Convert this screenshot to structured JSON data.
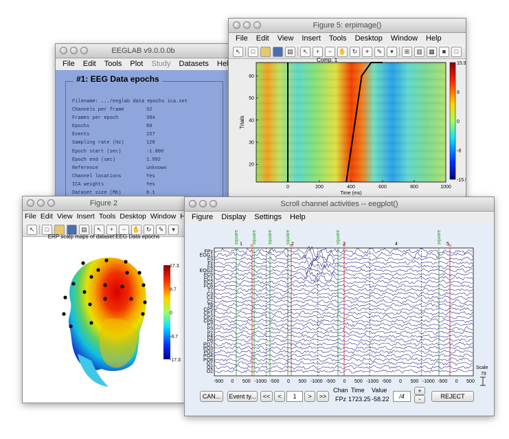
{
  "eeglab": {
    "title": "EEGLAB v9.0.0.0b",
    "menu": [
      "File",
      "Edit",
      "Tools",
      "Plot",
      "Study",
      "Datasets",
      "Help"
    ],
    "heading": "#1: EEG Data epochs",
    "info": [
      {
        "key": "Filename:  .../eeglab data epochs ica.set",
        "value": ""
      },
      {
        "key": "Channels per frame",
        "value": "32"
      },
      {
        "key": "Frames per epoch",
        "value": "384"
      },
      {
        "key": "Epochs",
        "value": "80"
      },
      {
        "key": "Events",
        "value": "157"
      },
      {
        "key": "Sampling rate (Hz)",
        "value": "128"
      },
      {
        "key": "Epoch start (sec)",
        "value": "-1.000"
      },
      {
        "key": "Epoch end (sec)",
        "value": "1.992"
      },
      {
        "key": "Reference",
        "value": "unknown"
      },
      {
        "key": "Channel locations",
        "value": "Yes"
      },
      {
        "key": "ICA weights",
        "value": "Yes"
      },
      {
        "key": "Dataset size (Mb)",
        "value": "8.1"
      }
    ]
  },
  "erpimage": {
    "title": "Figure 5: erpimage()",
    "menu": [
      "File",
      "Edit",
      "View",
      "Insert",
      "Tools",
      "Desktop",
      "Window",
      "Help"
    ],
    "plot_title": "Comp. 1",
    "xlabel": "Time (ms)",
    "ylabel": "Trials",
    "xticks": [
      "0",
      "200",
      "400",
      "600",
      "800",
      "1000"
    ],
    "yticks": [
      "20",
      "30",
      "40",
      "50",
      "60"
    ],
    "colorbar_ticks": [
      "15.9",
      "8",
      "0",
      "-8",
      "-15.9"
    ]
  },
  "figure2": {
    "title": "Figure 2",
    "menu": [
      "File",
      "Edit",
      "View",
      "Insert",
      "Tools",
      "Desktop",
      "Window",
      "Help"
    ],
    "plot_title": "ERP scalp maps of dataset:EEG Data epochs",
    "colorbar_ticks": [
      "17.3",
      "8.7",
      "0",
      "-8.7",
      "-17.3"
    ]
  },
  "eegplot": {
    "title": "Scroll channel activities -- eegplot()",
    "menu": [
      "Figure",
      "Display",
      "Settings",
      "Help"
    ],
    "event_labels": [
      "square",
      "square",
      "square",
      "square",
      "square",
      "square"
    ],
    "epoch_numbers": [
      "1",
      "2",
      "3",
      "4",
      "5"
    ],
    "red_markers": [
      "rt",
      "rt",
      "rt",
      "rt"
    ],
    "channels": [
      "FPz",
      "EOG1",
      "F3",
      "Fz",
      "F4",
      "EOG2",
      "FC5",
      "FC1",
      "FC2",
      "FC6",
      "T7",
      "C3",
      "C4",
      "Cz",
      "T8",
      "CP5",
      "CP1",
      "CP2",
      "CP6",
      "P7",
      "P3",
      "Pz",
      "P4",
      "P8",
      "PO7",
      "PO3",
      "POz",
      "PO4",
      "PO8",
      "O1",
      "Oz",
      "O2"
    ],
    "xticks": [
      "-500",
      "0",
      "500",
      "-1000",
      "-500",
      "0",
      "500",
      "-1000",
      "-500",
      "0",
      "500",
      "-1000",
      "-500",
      "0",
      "500",
      "-1000",
      "-500",
      "0",
      "500"
    ],
    "scale_label": "Scale",
    "scale_value": "79",
    "buttons": {
      "cancel": "CAN...",
      "event_types": "Event ty...",
      "prev_page": "<<",
      "prev": "<",
      "page": "1",
      "next": ">",
      "next_page": ">>",
      "zoom_in": "+",
      "zoom_out": "-",
      "reject": "REJECT"
    },
    "readout": {
      "chan_label": "Chan",
      "time_label": "Time",
      "value_label": "Value",
      "chan": "FPz",
      "time": "1723.25",
      "value": "-58.22",
      "scale_box": "/4"
    }
  }
}
